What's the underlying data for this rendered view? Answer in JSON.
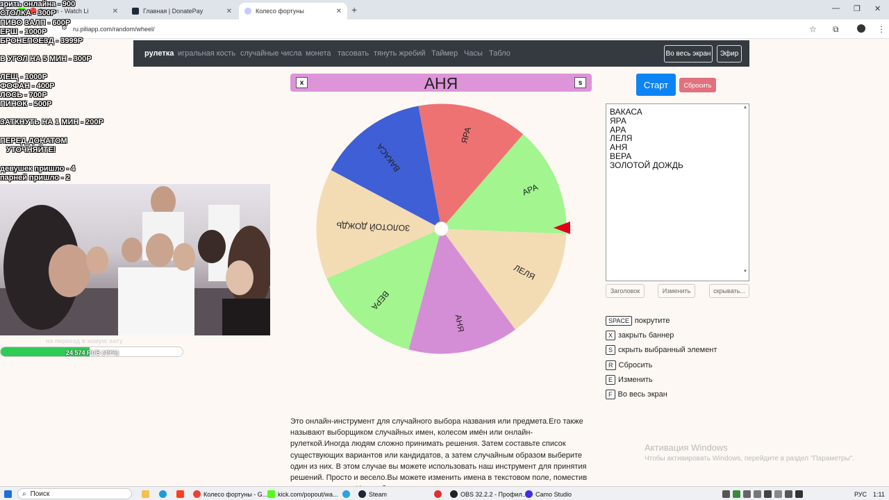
{
  "browser": {
    "tabs": [
      {
        "title": "🔴 Stream - Watch Li",
        "favicon_color": "#53fc18"
      },
      {
        "title": "Главная | DonatePay",
        "favicon_color": "#1d2a3a"
      },
      {
        "title": "Колесо фортуны",
        "favicon_color": "#c9c9ff"
      }
    ],
    "url": "ru.piliapp.com/random/wheel/"
  },
  "nav": {
    "items": [
      "рулетка",
      "игральная кость",
      "случайные числа",
      "монета",
      "тасовать",
      "тянуть жребий",
      "Таймер",
      "Часы",
      "Табло"
    ],
    "fullscreen_label": "Во весь экран",
    "air_label": "Эфир"
  },
  "wheel": {
    "chosen": "АНЯ",
    "close_key": "x",
    "hide_key": "s",
    "segments": [
      {
        "label": "ВАКАСА",
        "color": "#3f5fd6"
      },
      {
        "label": "ЯРА",
        "color": "#ee7272"
      },
      {
        "label": "АРА",
        "color": "#a2f58f"
      },
      {
        "label": "ЛЕЛЯ",
        "color": "#f3dcb4"
      },
      {
        "label": "АНЯ",
        "color": "#d48ed6"
      },
      {
        "label": "ВЕРА",
        "color": "#a2f58f"
      },
      {
        "label": "ЗОЛОТОЙ ДОЖДЬ",
        "color": "#f3dcb4"
      }
    ],
    "pointer_color": "#e0001b"
  },
  "controls": {
    "start_label": "Старт",
    "reset_label": "Сбросить",
    "names": [
      "ВАКАСА",
      "ЯРА",
      "АРА",
      "ЛЕЛЯ",
      "АНЯ",
      "ВЕРА",
      "ЗОЛОТОЙ ДОЖДЬ"
    ],
    "title_btn": "Заголовок",
    "edit_btn": "Изменить",
    "hide_btn": "скрывать..."
  },
  "shortcuts": [
    {
      "key": "SPACE",
      "label": "покрутите"
    },
    {
      "key": "X",
      "label": "закрыть баннер"
    },
    {
      "key": "S",
      "label": "скрыть выбранный элемент"
    },
    {
      "key": "R",
      "label": "Сбросить"
    },
    {
      "key": "E",
      "label": "Изменить"
    },
    {
      "key": "F",
      "label": "Во весь экран"
    }
  ],
  "description": "Это онлайн-инструмент для случайного выбора названия или предмета.Его также называют выборщиком случайных имен, колесом имён или онлайн-рулеткой.Иногда людям сложно принимать решения. Затем составьте список существующих вариантов или кандидатов, а затем случайным образом выберите один из них. В этом случае вы можете использовать наш инструмент для принятия решений. Просто и весело.Вы можете изменить имена в текстовом поле, поместив одно имя в строку.Имена будут",
  "activation": {
    "title": "Активация Windows",
    "subtitle": "Чтобы активировать Windows, перейдите в раздел \"Параметры\"."
  },
  "overlay": {
    "lines": [
      "зрить онлайна - 900",
      "СТОЛКА - 300Р",
      "ПИВО ЗАЛП - 600Р",
      "ЕРШ - 1000Р",
      "БРОНЕПОЕЗД - 3999Р",
      "В УГОЛ НА 5 МИН - 300Р",
      "ЛЕЩ - 1000Р",
      "ФОФАН - 400Р",
      "ЛОСЬ - 700Р",
      "ПИНОК - 500Р",
      "ЗАТКНУТЬ НА 1 МИН - 200Р",
      "ПЕРЕД ДОНАТОМ",
      "   УТОЧНЯЙТЕ!",
      "девушек пришло - 4",
      "парней пришло - 2"
    ],
    "progress_caption": "на переезд в новую хату",
    "progress_text": "24 574 RUB (49%)",
    "progress_fraction": 0.49
  },
  "taskbar": {
    "search_label": "Поиск",
    "items": [
      {
        "label": "Колесо фортуны - G...",
        "color": "#e94235"
      },
      {
        "label": "kick.com/popout/wa...",
        "color": "#53fc18"
      },
      {
        "label": "Steam",
        "color": "#1b2838"
      },
      {
        "label": "OBS 32.2.2 - Профил...",
        "color": "#222"
      },
      {
        "label": "Camo Studio",
        "color": "#3b2fe0"
      }
    ],
    "lang": "РУС",
    "time": "1:11"
  }
}
